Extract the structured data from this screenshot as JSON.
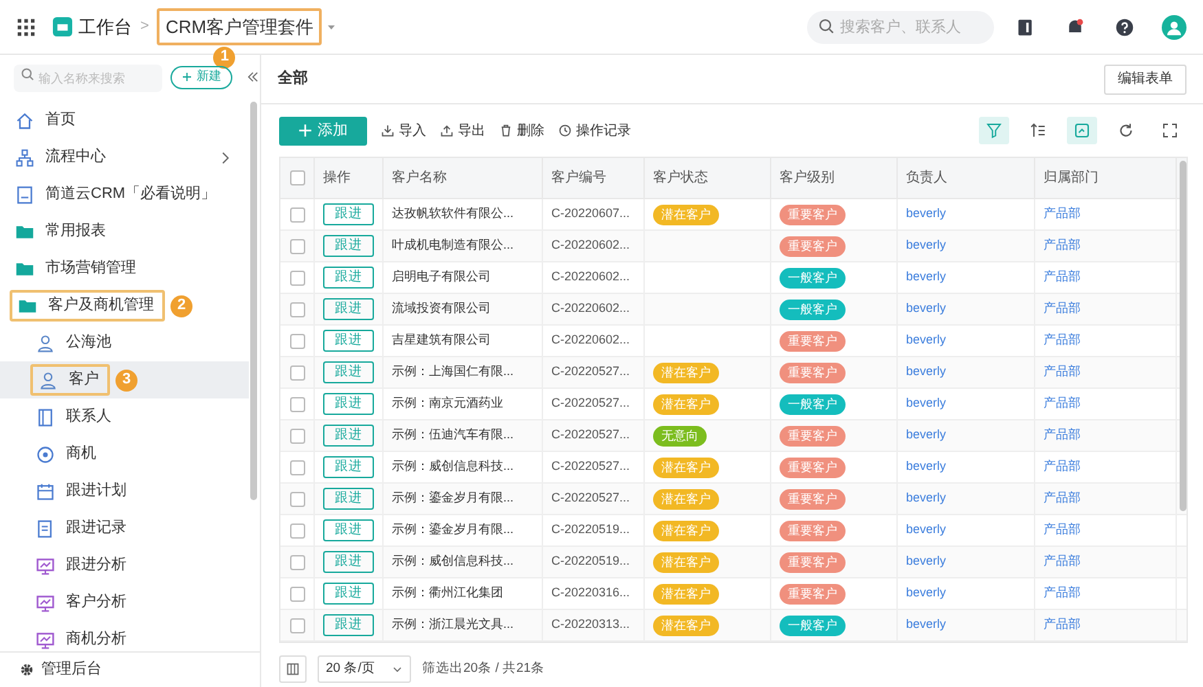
{
  "topbar": {
    "home": "工作台",
    "separator": ">",
    "current": {
      "label": "CRM客户管理套件",
      "annotation": "1"
    },
    "search": {
      "placeholder": "搜索客户、联系人"
    }
  },
  "sidebar": {
    "search": {
      "placeholder": "输入名称来搜索"
    },
    "new_button": "新建",
    "items": [
      {
        "kind": "home",
        "label": "首页"
      },
      {
        "kind": "flow",
        "label": "流程中心",
        "has_arrow": true
      },
      {
        "kind": "doc",
        "label": "简道云CRM「必看说明」"
      },
      {
        "kind": "folder",
        "label": "常用报表"
      },
      {
        "kind": "folder",
        "label": "市场营销管理"
      },
      {
        "kind": "folder",
        "label": "客户及商机管理",
        "annotation": "2",
        "children": [
          {
            "kind": "user",
            "label": "公海池",
            "selected": false
          },
          {
            "kind": "user",
            "label": "客户",
            "selected": true,
            "annotation": "3"
          },
          {
            "kind": "contact",
            "label": "联系人",
            "selected": false
          },
          {
            "kind": "target",
            "label": "商机",
            "selected": false
          },
          {
            "kind": "calendar",
            "label": "跟进计划",
            "selected": false
          },
          {
            "kind": "record",
            "label": "跟进记录",
            "selected": false
          },
          {
            "kind": "chart",
            "label": "跟进分析",
            "selected": false
          },
          {
            "kind": "chart",
            "label": "客户分析",
            "selected": false
          },
          {
            "kind": "chart",
            "label": "商机分析",
            "selected": false
          }
        ]
      }
    ],
    "footer": "管理后台"
  },
  "view": {
    "title": "全部",
    "edit_button": "编辑表单"
  },
  "toolbar": {
    "add": "添加",
    "actions": [
      {
        "kind": "import",
        "label": "导入"
      },
      {
        "kind": "export",
        "label": "导出"
      },
      {
        "kind": "delete",
        "label": "删除"
      },
      {
        "kind": "log",
        "label": "操作记录"
      }
    ]
  },
  "table": {
    "select_all": {
      "checked": false
    },
    "columns": [
      "操作",
      "客户名称",
      "客户编号",
      "客户状态",
      "客户级别",
      "负责人",
      "归属部门"
    ],
    "rows": [
      {
        "checked": false,
        "action": "跟进",
        "name": "达孜帆软软件有限公...",
        "code": "C-20220607...",
        "status": {
          "text": "潜在客户",
          "color": "#f2b824"
        },
        "level": {
          "text": "重要客户",
          "color": "#f0907e"
        },
        "owner": "beverly",
        "dept": "产品部"
      },
      {
        "checked": false,
        "action": "跟进",
        "name": "叶成机电制造有限公...",
        "code": "C-20220602...",
        "level": {
          "text": "重要客户",
          "color": "#f0907e"
        },
        "owner": "beverly",
        "dept": "产品部"
      },
      {
        "checked": false,
        "action": "跟进",
        "name": "启明电子有限公司",
        "code": "C-20220602...",
        "level": {
          "text": "一般客户",
          "color": "#14bdbd"
        },
        "owner": "beverly",
        "dept": "产品部"
      },
      {
        "checked": false,
        "action": "跟进",
        "name": "流域投资有限公司",
        "code": "C-20220602...",
        "level": {
          "text": "一般客户",
          "color": "#14bdbd"
        },
        "owner": "beverly",
        "dept": "产品部"
      },
      {
        "checked": false,
        "action": "跟进",
        "name": "吉星建筑有限公司",
        "code": "C-20220602...",
        "level": {
          "text": "重要客户",
          "color": "#f0907e"
        },
        "owner": "beverly",
        "dept": "产品部"
      },
      {
        "checked": false,
        "action": "跟进",
        "name": "示例：上海国仁有限...",
        "code": "C-20220527...",
        "status": {
          "text": "潜在客户",
          "color": "#f2b824"
        },
        "level": {
          "text": "重要客户",
          "color": "#f0907e"
        },
        "owner": "beverly",
        "dept": "产品部"
      },
      {
        "checked": false,
        "action": "跟进",
        "name": "示例：南京元酒药业",
        "code": "C-20220527...",
        "status": {
          "text": "潜在客户",
          "color": "#f2b824"
        },
        "level": {
          "text": "一般客户",
          "color": "#14bdbd"
        },
        "owner": "beverly",
        "dept": "产品部"
      },
      {
        "checked": false,
        "action": "跟进",
        "name": "示例：伍迪汽车有限...",
        "code": "C-20220527...",
        "status": {
          "text": "无意向",
          "color": "#7cbd1e"
        },
        "level": {
          "text": "重要客户",
          "color": "#f0907e"
        },
        "owner": "beverly",
        "dept": "产品部"
      },
      {
        "checked": false,
        "action": "跟进",
        "name": "示例：威创信息科技...",
        "code": "C-20220527...",
        "status": {
          "text": "潜在客户",
          "color": "#f2b824"
        },
        "level": {
          "text": "重要客户",
          "color": "#f0907e"
        },
        "owner": "beverly",
        "dept": "产品部"
      },
      {
        "checked": false,
        "action": "跟进",
        "name": "示例：鎏金岁月有限...",
        "code": "C-20220527...",
        "status": {
          "text": "潜在客户",
          "color": "#f2b824"
        },
        "level": {
          "text": "重要客户",
          "color": "#f0907e"
        },
        "owner": "beverly",
        "dept": "产品部"
      },
      {
        "checked": false,
        "action": "跟进",
        "name": "示例：鎏金岁月有限...",
        "code": "C-20220519...",
        "status": {
          "text": "潜在客户",
          "color": "#f2b824"
        },
        "level": {
          "text": "重要客户",
          "color": "#f0907e"
        },
        "owner": "beverly",
        "dept": "产品部"
      },
      {
        "checked": false,
        "action": "跟进",
        "name": "示例：威创信息科技...",
        "code": "C-20220519...",
        "status": {
          "text": "潜在客户",
          "color": "#f2b824"
        },
        "level": {
          "text": "重要客户",
          "color": "#f0907e"
        },
        "owner": "beverly",
        "dept": "产品部"
      },
      {
        "checked": false,
        "action": "跟进",
        "name": "示例：衢州江化集团",
        "code": "C-20220316...",
        "status": {
          "text": "潜在客户",
          "color": "#f2b824"
        },
        "level": {
          "text": "重要客户",
          "color": "#f0907e"
        },
        "owner": "beverly",
        "dept": "产品部"
      },
      {
        "checked": false,
        "action": "跟进",
        "name": "示例：浙江晨光文具...",
        "code": "C-20220313...",
        "status": {
          "text": "潜在客户",
          "color": "#f2b824"
        },
        "level": {
          "text": "一般客户",
          "color": "#14bdbd"
        },
        "owner": "beverly",
        "dept": "产品部"
      }
    ]
  },
  "pagination": {
    "page_size": "20 条/页",
    "summary": "筛选出20条 / 共21条"
  }
}
